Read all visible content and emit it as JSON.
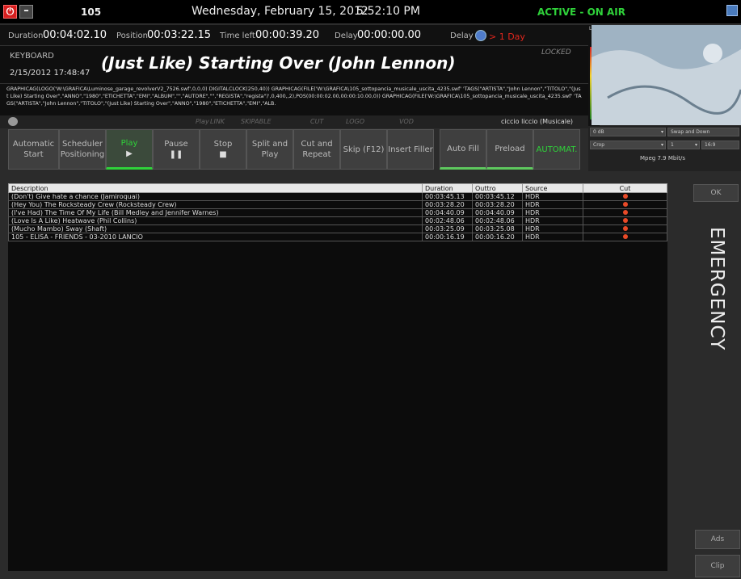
{
  "topbar": {
    "power_icon": "power-icon",
    "minimize_icon": "minimize-icon",
    "station": "105",
    "date": "Wednesday, February 15, 2012",
    "clock": "5:52:10 PM",
    "status": "ACTIVE - ON AIR"
  },
  "times": {
    "duration_label": "Duration",
    "duration": "00:04:02.10",
    "position_label": "Position",
    "position": "00:03:22.15",
    "timeleft_label": "Time left",
    "timeleft": "00:00:39.20",
    "delay_label": "Delay",
    "delay": "00:00:00.00",
    "delay2_label": "Delay",
    "delay_red": "> 1 Day"
  },
  "now_playing": {
    "source": "KEYBOARD",
    "timestamp": "2/15/2012  17:48:47",
    "title": "(Just Like) Starting Over  (John Lennon)",
    "locked": "LOCKED"
  },
  "graphic_text": "GRAPHICAG(LOGO('W:\\GRAFICA\\Luminose_garage_revolverV2_7526.swf',0,0,0) DIGITALCLOCK(250,40)) GRAPHICAG(FILE('W:\\GRAFICA\\105_sottopancia_musicale_uscita_4235.swf' 'TAGS(\"ARTISTA\",\"John Lennon\",\"TITOLO\",\"(Just Like) Starting Over\",\"ANNO\",\"1980\",\"ETICHETTA\",\"EMI\",\"ALBUM\",\"\",\"AUTORE\",\"\",\"REGISTA\",\"regista\")',0,400,,2),POS(00:00:02.00,00:00:10.00,0)) GRAPHICAG(FILE('W:\\GRAFICA\\105_sottopancia_musicale_uscita_4235.swf' 'TAGS(\"ARTISTA\",\"John Lennon\",\"TITOLO\",\"(Just Like) Starting Over\",\"ANNO\",\"1980\",\"ETICHETTA\",\"EMI\",\"ALB.",
  "flags": {
    "play": "Play",
    "link": "LINK",
    "skipable": "SKIPABLE",
    "cut": "CUT",
    "logo": "LOGO",
    "vod": "VOD",
    "user": "ciccio liccio (Musicale)"
  },
  "buttons": {
    "auto_start": "Automatic Start",
    "scheduler": "Scheduler Positioning",
    "play": "Play",
    "pause": "Pause",
    "stop": "Stop",
    "split_play": "Split and Play",
    "cut_repeat": "Cut and Repeat",
    "skip": "Skip (F12)",
    "insert_filler": "Insert Filler",
    "auto_fill": "Auto Fill",
    "preload": "Preload",
    "automat": "AUTOMAT."
  },
  "controls": {
    "meter_lr": "L R",
    "gain": "0 dB",
    "mode": "Swap and Down",
    "crop": "Crop",
    "crop_val": "1",
    "aspect": "16:9",
    "codec": "Mpeg 7.9 Mbit/s"
  },
  "table": {
    "headers": [
      "Description",
      "Duration",
      "Outtro",
      "Source",
      "Cut"
    ],
    "rows": [
      [
        "(Don't) Give hate a chance  (Jamiroquai)",
        "00:03:45.13",
        "00:03:45.12",
        "HDR"
      ],
      [
        "(Hey You) The Rocksteady Crew  (Rocksteady Crew)",
        "00:03:28.20",
        "00:03:28.20",
        "HDR"
      ],
      [
        "(I've Had) The Time Of My Life  (Bill Medley and Jennifer Warnes)",
        "00:04:40.09",
        "00:04:40.09",
        "HDR"
      ],
      [
        "(Love Is A Like) Heatwave  (Phil Collins)",
        "00:02:48.06",
        "00:02:48.06",
        "HDR"
      ],
      [
        "(Mucho Mambo) Sway  (Shaft)",
        "00:03:25.09",
        "00:03:25.08",
        "HDR"
      ],
      [
        "105 - ELISA - FRIENDS - 03-2010 LANCIO",
        "00:00:16.19",
        "00:00:16.20",
        "HDR"
      ]
    ]
  },
  "side": {
    "ok": "OK",
    "emergency": "EMERGENCY",
    "ads": "Ads",
    "clip": "Clip"
  }
}
